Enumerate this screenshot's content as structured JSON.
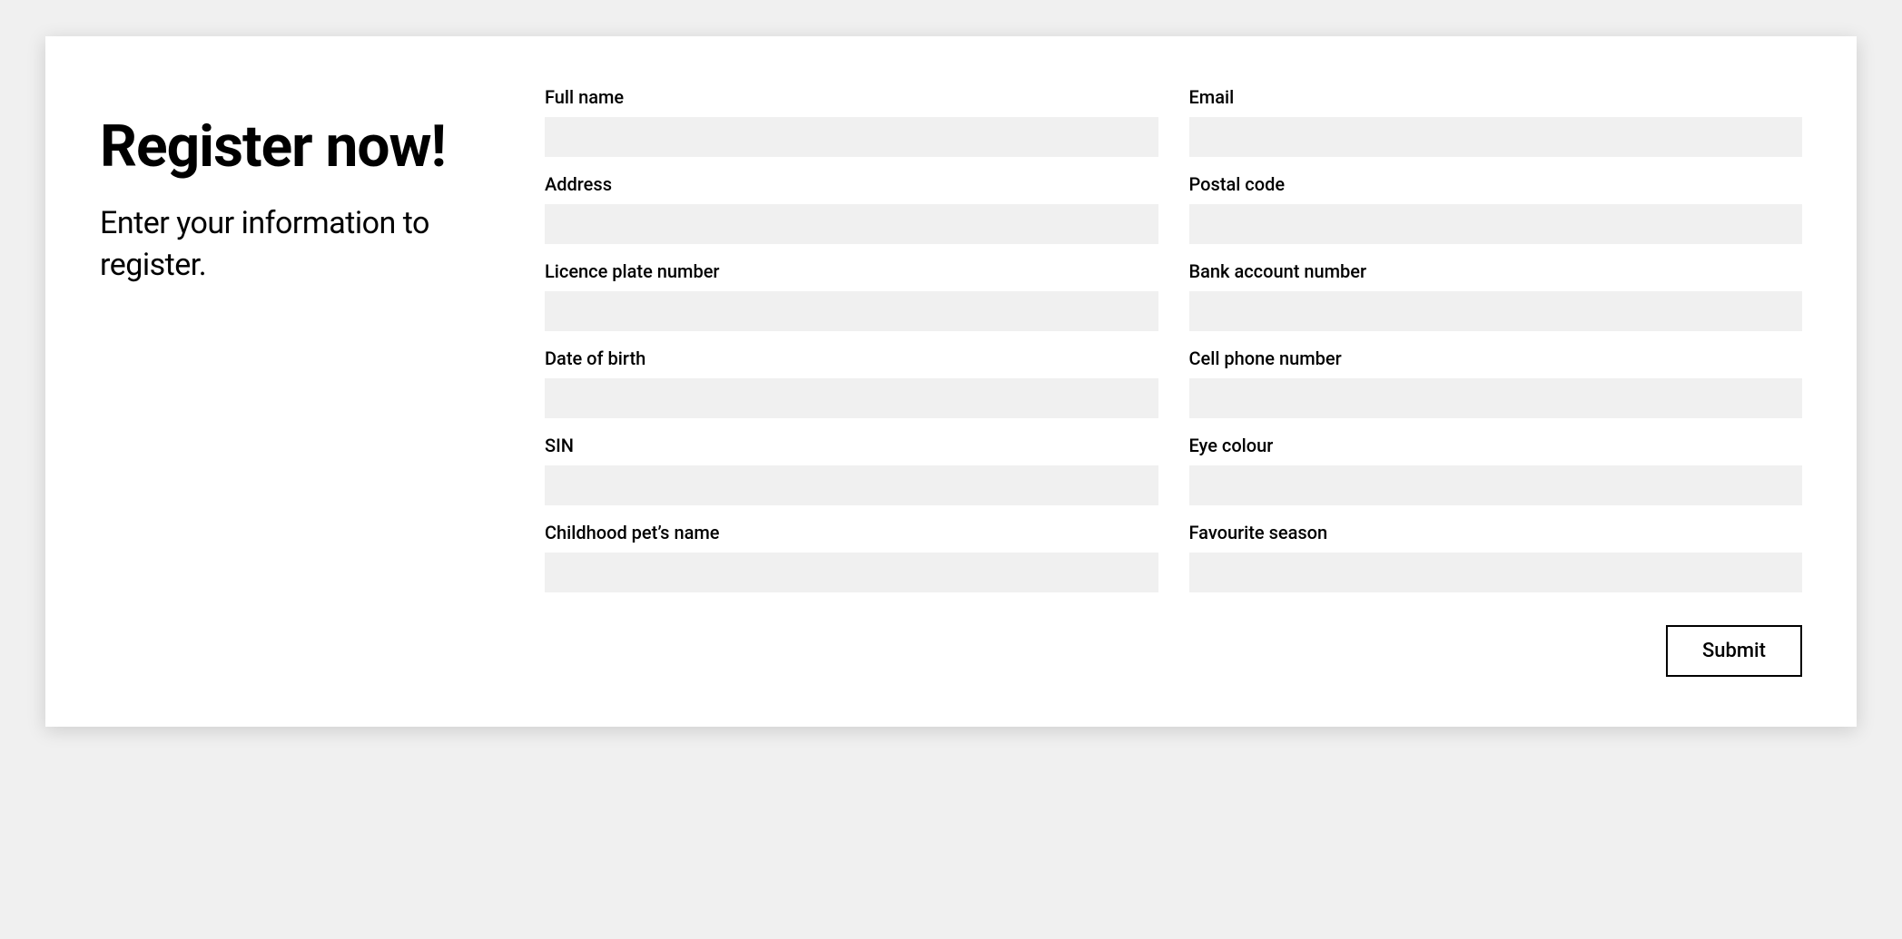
{
  "header": {
    "title": "Register now!",
    "subtitle": "Enter your information to register."
  },
  "form": {
    "fields": [
      {
        "label": "Full name",
        "value": ""
      },
      {
        "label": "Email",
        "value": ""
      },
      {
        "label": "Address",
        "value": ""
      },
      {
        "label": "Postal code",
        "value": ""
      },
      {
        "label": "Licence plate number",
        "value": ""
      },
      {
        "label": "Bank account number",
        "value": ""
      },
      {
        "label": "Date of birth",
        "value": ""
      },
      {
        "label": "Cell phone number",
        "value": ""
      },
      {
        "label": "SIN",
        "value": ""
      },
      {
        "label": "Eye colour",
        "value": ""
      },
      {
        "label": "Childhood pet’s name",
        "value": ""
      },
      {
        "label": "Favourite season",
        "value": ""
      }
    ],
    "submit_label": "Submit"
  }
}
